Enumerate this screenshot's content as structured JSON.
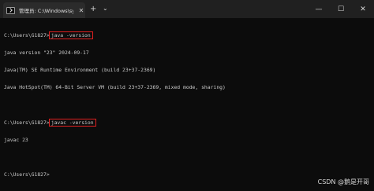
{
  "window": {
    "tab_title": "管理员: C:\\Windows\\system32",
    "new_tab_symbol": "+",
    "dropdown_symbol": "⌄",
    "controls": {
      "minimize": "—",
      "maximize": "☐",
      "close": "✕"
    }
  },
  "terminal": {
    "prompt1": "C:\\Users\\G1827>",
    "cmd1": "java -version",
    "out1a": "java version \"23\" 2024-09-17",
    "out1b": "Java(TM) SE Runtime Environment (build 23+37-2369)",
    "out1c": "Java HotSpot(TM) 64-Bit Server VM (build 23+37-2369, mixed mode, sharing)",
    "prompt2": "C:\\Users\\G1827>",
    "cmd2": "javac -version",
    "out2a": "javac 23",
    "prompt3": "C:\\Users\\G1827>"
  },
  "watermark": "CSDN @鹅是开哥"
}
